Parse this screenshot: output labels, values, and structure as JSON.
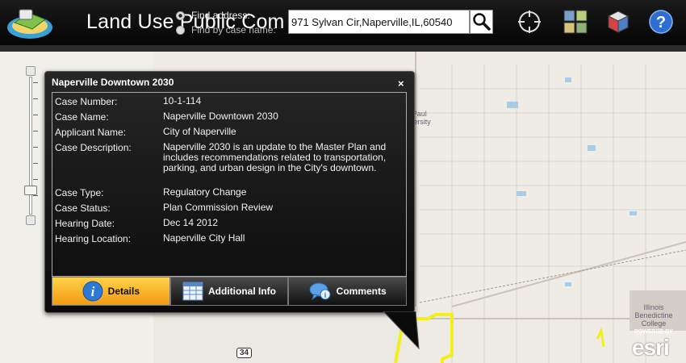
{
  "header": {
    "title": "Land Use Public Com",
    "search_options": [
      {
        "label": "Find address:",
        "selected": true
      },
      {
        "label": "Find by case name:",
        "selected": false
      }
    ],
    "search_value": "971 Sylvan Cir,Naperville,IL,60540"
  },
  "tools": [
    {
      "icon": "crosshair-icon"
    },
    {
      "icon": "basemap-grid-icon"
    },
    {
      "icon": "legend-cube-icon"
    },
    {
      "icon": "help-icon"
    }
  ],
  "popup": {
    "title": "Naperville Downtown 2030",
    "close_label": "×",
    "fields": [
      {
        "label": "Case Number:",
        "value": "10-1-114"
      },
      {
        "label": "Case Name:",
        "value": "Naperville Downtown 2030"
      },
      {
        "label": "Applicant Name:",
        "value": "City of Naperville"
      },
      {
        "label": "Case Description:",
        "value": "Naperville 2030 is an update to the Master Plan and includes recommendations related to transportation, parking, and urban design in the City's downtown."
      },
      {
        "label": "Case Type:",
        "value": "Regulatory Change"
      },
      {
        "label": "Case Status:",
        "value": "Plan Commission Review"
      },
      {
        "label": "Hearing Date:",
        "value": "Dec 14 2012"
      },
      {
        "label": "Hearing Location:",
        "value": "Naperville City Hall"
      }
    ],
    "tabs": [
      {
        "label": "Details",
        "icon": "info-icon",
        "active": true
      },
      {
        "label": "Additional Info",
        "icon": "table-icon",
        "active": false
      },
      {
        "label": "Comments",
        "icon": "chat-bubble-icon",
        "active": false
      }
    ]
  },
  "map": {
    "labels": {
      "depaul": "DePaul University",
      "college": "Illinois Benedictine College",
      "highway": "34"
    }
  },
  "attribution": {
    "powered_by": "POWERED BY",
    "brand": "esri"
  },
  "colors": {
    "header_bg": "#0b0b0b",
    "active_tab": "#f5a81a",
    "highlight_boundary": "#f2ef1a",
    "water": "#a9cbe3",
    "map_bg": "#efece6"
  }
}
